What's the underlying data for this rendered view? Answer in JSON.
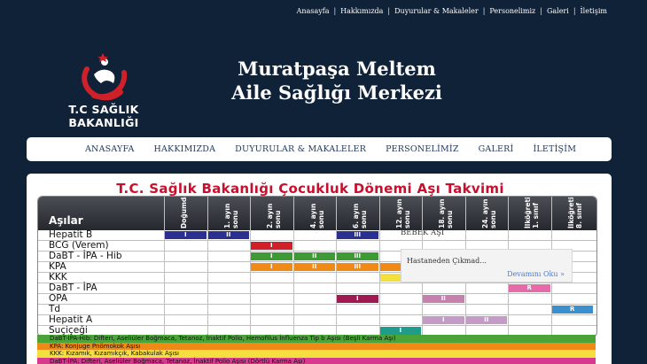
{
  "topnav": {
    "items": [
      "Anasayfa",
      "Hakkımızda",
      "Duyurular & Makaleler",
      "Personelimiz",
      "Galeri",
      "İletişim"
    ]
  },
  "logo": {
    "text": "T.C SAĞLIK BAKANLIĞI",
    "icon": "ministry-of-health-logo"
  },
  "site": {
    "title_line1": "Muratpaşa Meltem",
    "title_line2": "Aile Sağlığı Merkezi"
  },
  "mainnav": {
    "items": [
      "ANASAYFA",
      "HAKKIMIZDA",
      "DUYURULAR & MAKALELER",
      "PERSONELİMİZ",
      "GALERİ",
      "İLETİŞİM"
    ]
  },
  "vaccine_image": {
    "title": "T.C. Sağlık Bakanlığı Çocukluk Dönemi Aşı Takvimi",
    "header_label": "Aşılar",
    "columns": [
      "Doğumda",
      "1. ayın sonu",
      "2. ayın sonu",
      "4. ayın sonu",
      "6. ayın sonu",
      "12. ayın sonu",
      "18. ayın sonu",
      "24. ayın sonu",
      "İlköğretim 1. sınıf",
      "İlköğretim 8. sınıf"
    ],
    "rows": [
      "Hepatit B",
      "BCG (Verem)",
      "DaBT - İPA - Hib",
      "KPA",
      "KKK",
      "DaBT - İPA",
      "OPA",
      "Td",
      "Hepatit A",
      "Suçiçeği"
    ],
    "cells": [
      {
        "row": 0,
        "col": 0,
        "label": "I",
        "color": "#2b2f8f"
      },
      {
        "row": 0,
        "col": 1,
        "label": "II",
        "color": "#2b2f8f"
      },
      {
        "row": 0,
        "col": 4,
        "label": "III",
        "color": "#2b2f8f"
      },
      {
        "row": 1,
        "col": 2,
        "label": "I",
        "color": "#d0202a"
      },
      {
        "row": 2,
        "col": 2,
        "label": "I",
        "color": "#3e9a35"
      },
      {
        "row": 2,
        "col": 3,
        "label": "II",
        "color": "#3e9a35"
      },
      {
        "row": 2,
        "col": 4,
        "label": "III",
        "color": "#3e9a35"
      },
      {
        "row": 3,
        "col": 2,
        "label": "I",
        "color": "#ef8a17"
      },
      {
        "row": 3,
        "col": 3,
        "label": "II",
        "color": "#ef8a17"
      },
      {
        "row": 3,
        "col": 4,
        "label": "III",
        "color": "#ef8a17"
      },
      {
        "row": 3,
        "col": 5,
        "label": "",
        "color": "#ef8a17"
      },
      {
        "row": 4,
        "col": 5,
        "label": "",
        "color": "#f3df3e"
      },
      {
        "row": 5,
        "col": 8,
        "label": "R",
        "color": "#e46aa9"
      },
      {
        "row": 6,
        "col": 4,
        "label": "I",
        "color": "#a01a52"
      },
      {
        "row": 6,
        "col": 6,
        "label": "II",
        "color": "#c580ad"
      },
      {
        "row": 7,
        "col": 9,
        "label": "R",
        "color": "#3a8fcf"
      },
      {
        "row": 8,
        "col": 6,
        "label": "I",
        "color": "#c39bc6"
      },
      {
        "row": 8,
        "col": 7,
        "label": "II",
        "color": "#c39bc6"
      },
      {
        "row": 9,
        "col": 5,
        "label": "I",
        "color": "#1f9d8c"
      }
    ],
    "legend": [
      {
        "text": "DaBT-İPA-Hib: Difteri, Aseliüler Boğmaca, Tetanoz, İnaktif Polio, Hemofilus İnfluenza Tip b Aşısı (Beşli Karma Aşı)",
        "color": "#4aa43a"
      },
      {
        "text": "KPA: Konjuge Pnömokok Aşısı",
        "color": "#ef8a17"
      },
      {
        "text": "KKK: Kızamık, Kızamıkçık, Kabakulak Aşısı",
        "color": "#f3df3e"
      },
      {
        "text": "DaBT-İPA: Difteri, Aseliüler Boğmaca, Tetanoz, İnaktif Polio Aşısı (Dörtlü Karma Aşı)",
        "color": "#d63a8e"
      }
    ]
  },
  "overlay": {
    "bebek_label": "BEBEK AŞI",
    "popup_text": "Hastaneden Çıkmad...",
    "popup_link": "Devamını Oku »"
  }
}
